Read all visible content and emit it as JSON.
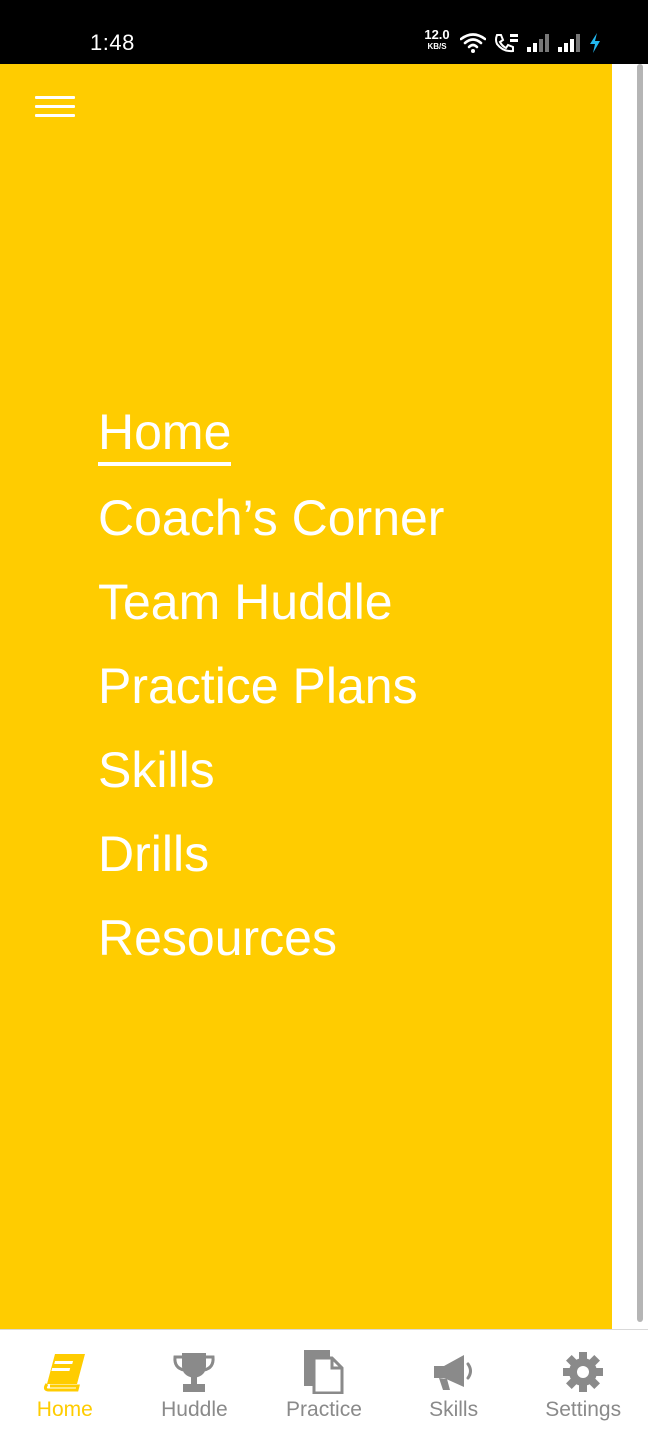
{
  "status_bar": {
    "time": "1:48",
    "speed_value": "12.0",
    "speed_unit": "KB/S"
  },
  "drawer": {
    "background": "#FFCC00",
    "items": [
      {
        "label": "Home",
        "active": true
      },
      {
        "label": "Coach’s Corner",
        "active": false
      },
      {
        "label": "Team Huddle",
        "active": false
      },
      {
        "label": "Practice Plans",
        "active": false
      },
      {
        "label": "Skills",
        "active": false
      },
      {
        "label": "Drills",
        "active": false
      },
      {
        "label": "Resources",
        "active": false
      }
    ]
  },
  "bottom_nav": {
    "active_color": "#FFCC00",
    "inactive_color": "#8a8a8a",
    "tabs": [
      {
        "label": "Home",
        "icon": "book-icon",
        "active": true
      },
      {
        "label": "Huddle",
        "icon": "trophy-icon",
        "active": false
      },
      {
        "label": "Practice",
        "icon": "documents-icon",
        "active": false
      },
      {
        "label": "Skills",
        "icon": "megaphone-icon",
        "active": false
      },
      {
        "label": "Settings",
        "icon": "gear-icon",
        "active": false
      }
    ]
  }
}
